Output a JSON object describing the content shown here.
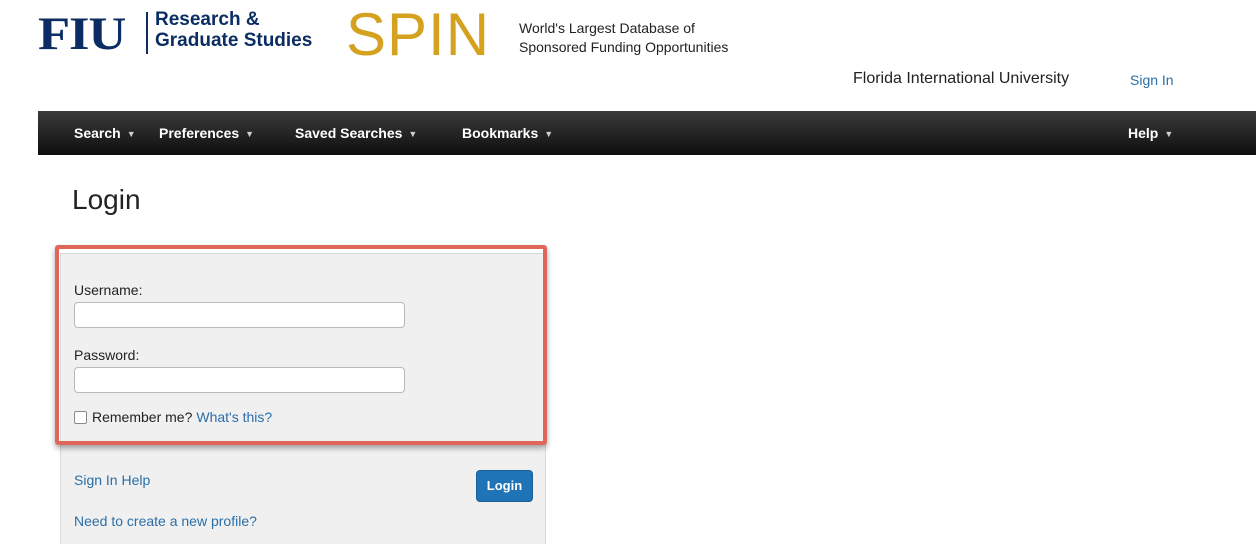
{
  "header": {
    "logo_fiu": "FIU",
    "logo_unit_line1": "Research &",
    "logo_unit_line2": "Graduate Studies",
    "logo_spin": "SPIN",
    "tagline_line1": "World's Largest Database of",
    "tagline_line2": "Sponsored Funding Opportunities",
    "university": "Florida International University",
    "sign_in": "Sign In",
    "colors": {
      "fiu_blue": "#0b2d63",
      "spin_gold": "#d4a21f",
      "link_blue": "#2a6fa8"
    }
  },
  "nav": {
    "items": [
      {
        "label": "Search",
        "icon": "chevron-down-icon"
      },
      {
        "label": "Preferences",
        "icon": "chevron-down-icon"
      },
      {
        "label": "Saved Searches",
        "icon": "chevron-down-icon"
      },
      {
        "label": "Bookmarks",
        "icon": "chevron-down-icon"
      }
    ],
    "help": {
      "label": "Help",
      "icon": "chevron-down-icon"
    }
  },
  "login": {
    "title": "Login",
    "username_label": "Username:",
    "username_value": "",
    "password_label": "Password:",
    "password_value": "",
    "remember_label": "Remember me?",
    "remember_checked": false,
    "whats_this": "What's this?",
    "sign_in_help": "Sign In Help",
    "new_profile": "Need to create a new profile?",
    "login_button": "Login",
    "colors": {
      "highlight_border": "#e0655b",
      "button": "#1f73b7"
    }
  }
}
